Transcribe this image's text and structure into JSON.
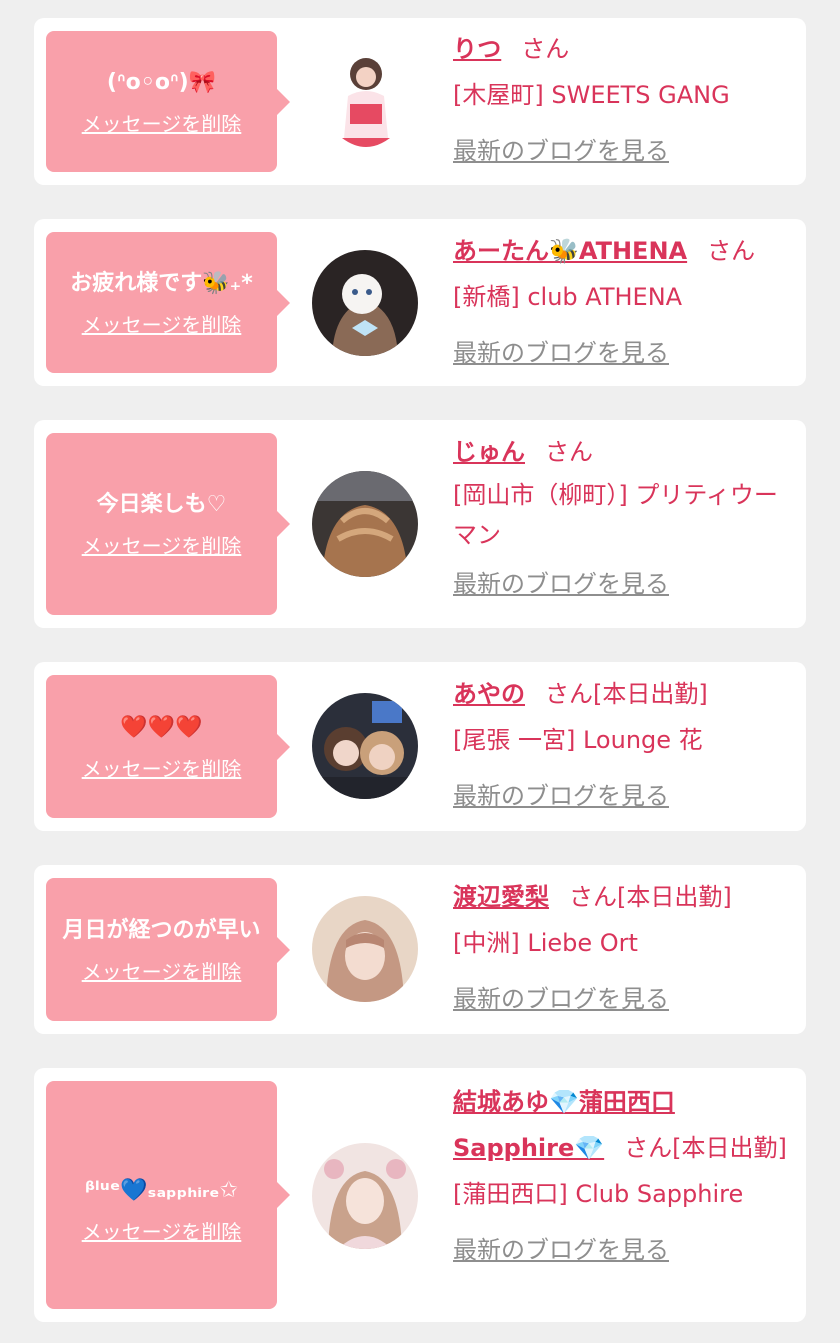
{
  "remove_label": "メッセージを削除",
  "blog_label": "最新のブログを見る",
  "honorific": "さん",
  "items": [
    {
      "message": "(ᐢo◦oᐢ)🎀",
      "name": "りつ",
      "status": "",
      "venue": "[木屋町] SWEETS GANG"
    },
    {
      "message": "お疲れ様です🐝₊*",
      "name": "あーたん🐝ATHENA",
      "status": "",
      "venue": "[新橋] club ATHENA"
    },
    {
      "message": "今日楽しも♡",
      "name": "じゅん",
      "status": "",
      "venue": "[岡山市（柳町）] プリティウーマン"
    },
    {
      "message": "❤️❤️❤️",
      "name": "あやの",
      "status": "[本日出勤]",
      "venue": "[尾張 一宮] Lounge 花"
    },
    {
      "message": "月日が経つのが早い",
      "name": "渡辺愛梨",
      "status": "[本日出勤]",
      "venue": "[中洲] Liebe Ort"
    },
    {
      "message": "ᵝˡᵘᵉ💙ₛₐₚₚₕᵢᵣₑ✩",
      "name": "結城あゆ💎蒲田西口Sapphire💎",
      "status": "[本日出勤]",
      "venue": "[蒲田西口] Club Sapphire"
    }
  ],
  "colors": {
    "accent": "#d9345a",
    "bubble": "#f9a0aa",
    "link_gray": "#8e8e8e",
    "background": "#efefef"
  }
}
